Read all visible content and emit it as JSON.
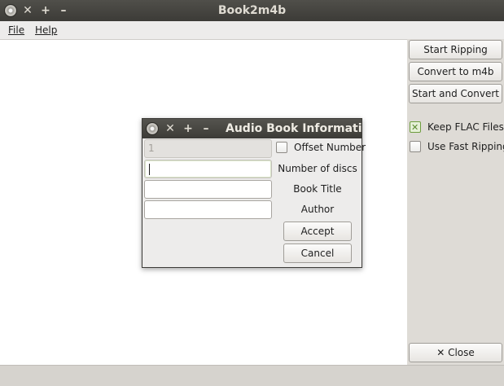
{
  "window": {
    "title": "Book2m4b"
  },
  "menu": {
    "file": "File",
    "help": "Help"
  },
  "actions": {
    "start_ripping": "Start Ripping",
    "convert_to_m4b": "Convert to m4b",
    "start_and_convert": "Start and Convert",
    "close": "Close"
  },
  "options": {
    "keep_flac": {
      "label": "Keep FLAC Files",
      "checked": true
    },
    "fast_ripping": {
      "label": "Use Fast Ripping",
      "checked": false
    }
  },
  "dialog": {
    "title": "Audio Book Informatio",
    "offset_value": "1",
    "offset_label": "Offset Number",
    "discs_label": "Number of discs",
    "discs_value": "",
    "title_label": "Book Title",
    "title_value": "",
    "author_label": "Author",
    "author_value": "",
    "accept": "Accept",
    "cancel": "Cancel"
  },
  "icons": {
    "close": "✕",
    "maximize": "+",
    "minimize": "–",
    "app": "disc-icon"
  }
}
